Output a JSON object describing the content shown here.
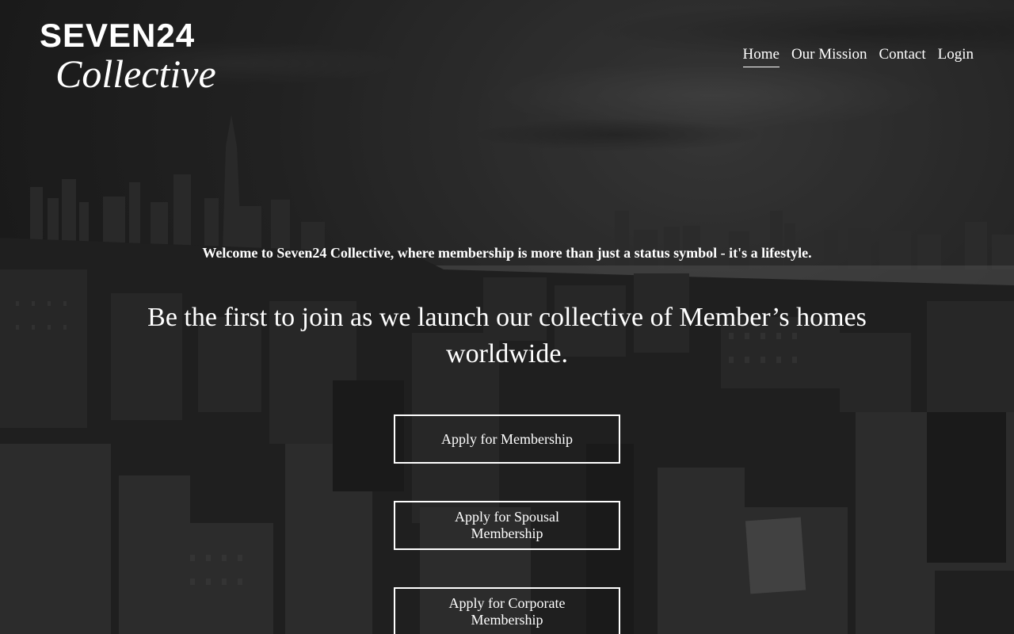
{
  "brand": {
    "name_top": "SEVEN24",
    "name_bottom": "Collective"
  },
  "nav": {
    "items": [
      {
        "label": "Home",
        "active": true
      },
      {
        "label": "Our Mission",
        "active": false
      },
      {
        "label": "Contact",
        "active": false
      },
      {
        "label": "Login",
        "active": false
      }
    ]
  },
  "hero": {
    "welcome": "Welcome to Seven24 Collective, where membership is more than just a status symbol - it's a lifestyle.",
    "headline": "Be the first to join as we launch our collective of Member’s homes worldwide.",
    "buttons": [
      {
        "label": "Apply for Membership"
      },
      {
        "label": "Apply for Spousal Membership"
      },
      {
        "label": "Apply for Corporate Membership"
      }
    ]
  },
  "colors": {
    "text": "#ffffff",
    "overlay": "#1c1c1c"
  }
}
